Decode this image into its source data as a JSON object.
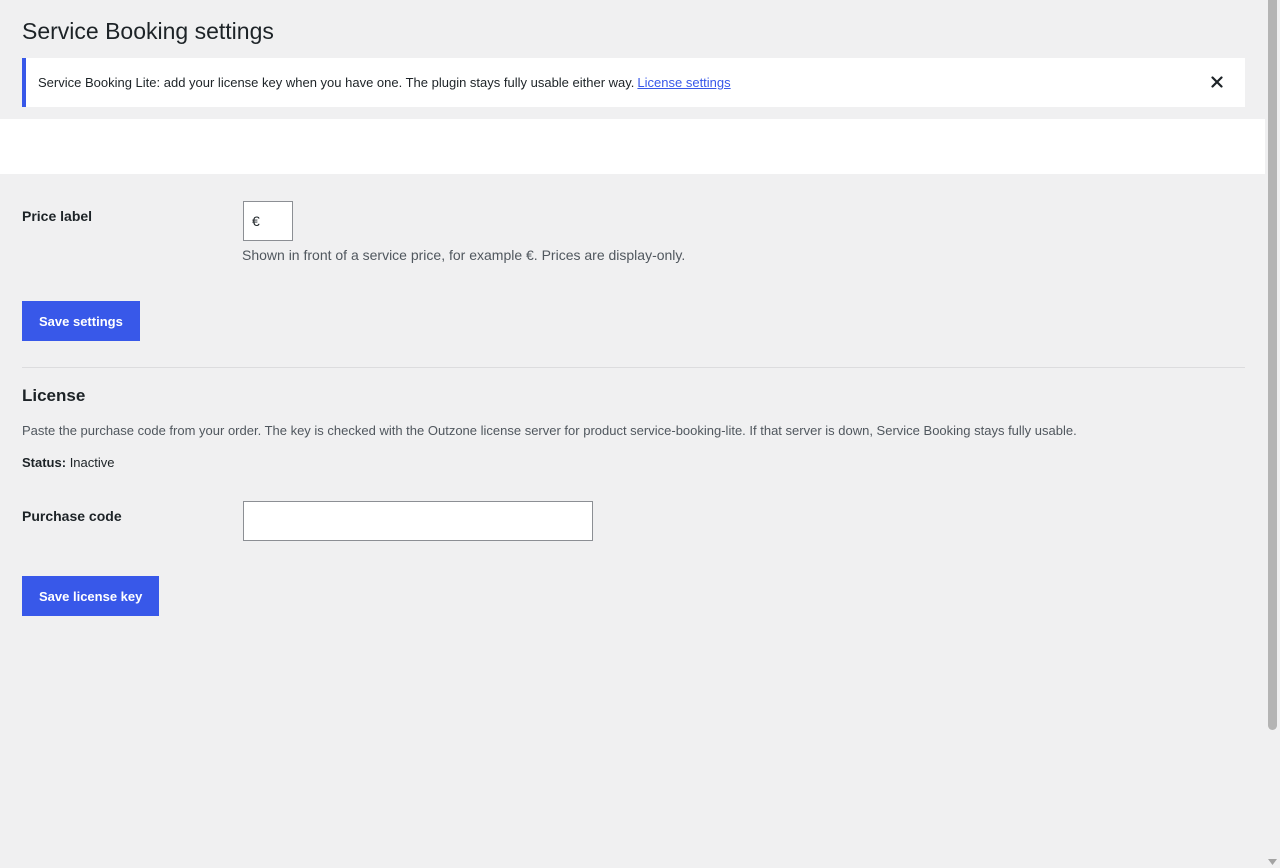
{
  "page": {
    "title": "Service Booking settings"
  },
  "notice": {
    "text": "Service Booking Lite: add your license key when you have one. The plugin stays fully usable either way.",
    "link_label": "License settings",
    "close_icon": "close-icon"
  },
  "general": {
    "price_label": "Price label",
    "price_value": "€",
    "price_help": "Shown in front of a service price, for example €. Prices are display-only.",
    "save_label": "Save settings"
  },
  "license": {
    "title": "License",
    "description": "Paste the purchase code from your order. The key is checked with the Outzone license server for product service-booking-lite. If that server is down, Service Booking stays fully usable.",
    "status_label": "Status:",
    "status_value": "Inactive",
    "code_label": "Purchase code",
    "code_value": "",
    "save_label": "Save license key"
  },
  "colors": {
    "accent": "#3858e9",
    "background": "#f0f0f1"
  }
}
